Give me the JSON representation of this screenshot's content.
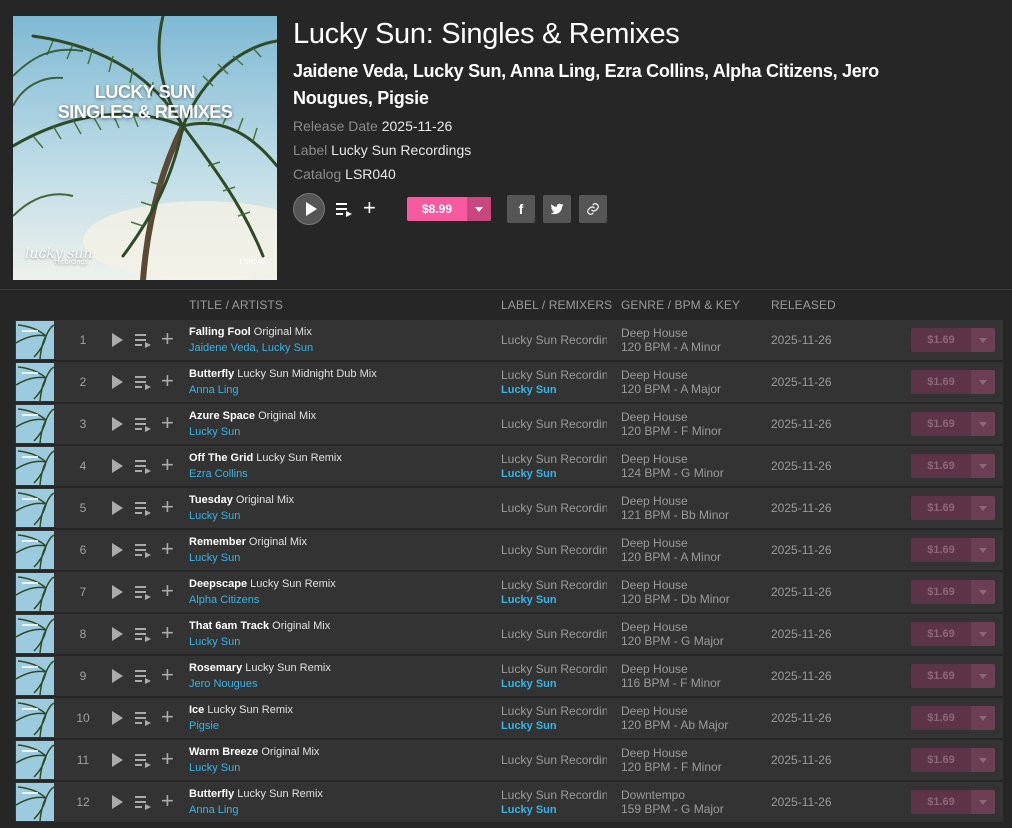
{
  "release": {
    "title": "Lucky Sun: Singles & Remixes",
    "artists": "Jaidene Veda, Lucky Sun, Anna Ling, Ezra Collins, Alpha Citizens, Jero Nougues, Pigsie",
    "release_date_label": "Release Date",
    "release_date": "2025-11-26",
    "label_label": "Label",
    "label": "Lucky Sun Recordings",
    "catalog_label": "Catalog",
    "catalog": "LSR040",
    "price": "$8.99"
  },
  "cover": {
    "title_line1": "LUCKY SUN",
    "title_line2": "SINGLES & REMIXES",
    "logo": "lucky sun",
    "logo_sub": "recordings",
    "catalog": "LSR040"
  },
  "share": {
    "facebook_glyph": "f"
  },
  "columns": {
    "title": "TITLE / ARTISTS",
    "label": "LABEL / REMIXERS",
    "genre": "GENRE / BPM & KEY",
    "released": "RELEASED"
  },
  "icons": {
    "play": "play-icon",
    "queue": "queue-icon",
    "add": "plus-icon",
    "facebook": "facebook-icon",
    "twitter": "twitter-icon",
    "link": "link-icon",
    "dropdown": "chevron-down-icon"
  },
  "colors": {
    "accent": "#f75a9e",
    "link": "#37b4e6",
    "row_bg": "#333333",
    "page_bg": "#262626"
  },
  "tracks": [
    {
      "num": "1",
      "name": "Falling Fool",
      "mix": "Original Mix",
      "artists": [
        "Jaidene Veda",
        "Lucky Sun"
      ],
      "label": "Lucky Sun Recordin",
      "remixer": "",
      "genre": "Deep House",
      "bpm_key": "120 BPM - A Minor",
      "released": "2025-11-26",
      "price": "$1.69"
    },
    {
      "num": "2",
      "name": "Butterfly",
      "mix": "Lucky Sun Midnight Dub Mix",
      "artists": [
        "Anna Ling"
      ],
      "label": "Lucky Sun Recordin",
      "remixer": "Lucky Sun",
      "genre": "Deep House",
      "bpm_key": "120 BPM - A Major",
      "released": "2025-11-26",
      "price": "$1.69"
    },
    {
      "num": "3",
      "name": "Azure Space",
      "mix": "Original Mix",
      "artists": [
        "Lucky Sun"
      ],
      "label": "Lucky Sun Recordin",
      "remixer": "",
      "genre": "Deep House",
      "bpm_key": "120 BPM - F Minor",
      "released": "2025-11-26",
      "price": "$1.69"
    },
    {
      "num": "4",
      "name": "Off The Grid",
      "mix": "Lucky Sun Remix",
      "artists": [
        "Ezra Collins"
      ],
      "label": "Lucky Sun Recordin",
      "remixer": "Lucky Sun",
      "genre": "Deep House",
      "bpm_key": "124 BPM - G Minor",
      "released": "2025-11-26",
      "price": "$1.69"
    },
    {
      "num": "5",
      "name": "Tuesday",
      "mix": "Original Mix",
      "artists": [
        "Lucky Sun"
      ],
      "label": "Lucky Sun Recordin",
      "remixer": "",
      "genre": "Deep House",
      "bpm_key": "121 BPM - Bb Minor",
      "released": "2025-11-26",
      "price": "$1.69"
    },
    {
      "num": "6",
      "name": "Remember",
      "mix": "Original Mix",
      "artists": [
        "Lucky Sun"
      ],
      "label": "Lucky Sun Recordin",
      "remixer": "",
      "genre": "Deep House",
      "bpm_key": "120 BPM - A Minor",
      "released": "2025-11-26",
      "price": "$1.69"
    },
    {
      "num": "7",
      "name": "Deepscape",
      "mix": "Lucky Sun Remix",
      "artists": [
        "Alpha Citizens"
      ],
      "label": "Lucky Sun Recordin",
      "remixer": "Lucky Sun",
      "genre": "Deep House",
      "bpm_key": "120 BPM - Db Minor",
      "released": "2025-11-26",
      "price": "$1.69"
    },
    {
      "num": "8",
      "name": "That 6am Track",
      "mix": "Original Mix",
      "artists": [
        "Lucky Sun"
      ],
      "label": "Lucky Sun Recordin",
      "remixer": "",
      "genre": "Deep House",
      "bpm_key": "120 BPM - G Major",
      "released": "2025-11-26",
      "price": "$1.69"
    },
    {
      "num": "9",
      "name": "Rosemary",
      "mix": "Lucky Sun Remix",
      "artists": [
        "Jero Nougues"
      ],
      "label": "Lucky Sun Recordin",
      "remixer": "Lucky Sun",
      "genre": "Deep House",
      "bpm_key": "116 BPM - F Minor",
      "released": "2025-11-26",
      "price": "$1.69"
    },
    {
      "num": "10",
      "name": "Ice",
      "mix": "Lucky Sun Remix",
      "artists": [
        "Pigsie"
      ],
      "label": "Lucky Sun Recordin",
      "remixer": "Lucky Sun",
      "genre": "Deep House",
      "bpm_key": "120 BPM - Ab Major",
      "released": "2025-11-26",
      "price": "$1.69"
    },
    {
      "num": "11",
      "name": "Warm Breeze",
      "mix": "Original Mix",
      "artists": [
        "Lucky Sun"
      ],
      "label": "Lucky Sun Recordin",
      "remixer": "",
      "genre": "Deep House",
      "bpm_key": "120 BPM - F Minor",
      "released": "2025-11-26",
      "price": "$1.69"
    },
    {
      "num": "12",
      "name": "Butterfly",
      "mix": "Lucky Sun Remix",
      "artists": [
        "Anna Ling"
      ],
      "label": "Lucky Sun Recordin",
      "remixer": "Lucky Sun",
      "genre": "Downtempo",
      "bpm_key": "159 BPM - G Major",
      "released": "2025-11-26",
      "price": "$1.69"
    }
  ]
}
